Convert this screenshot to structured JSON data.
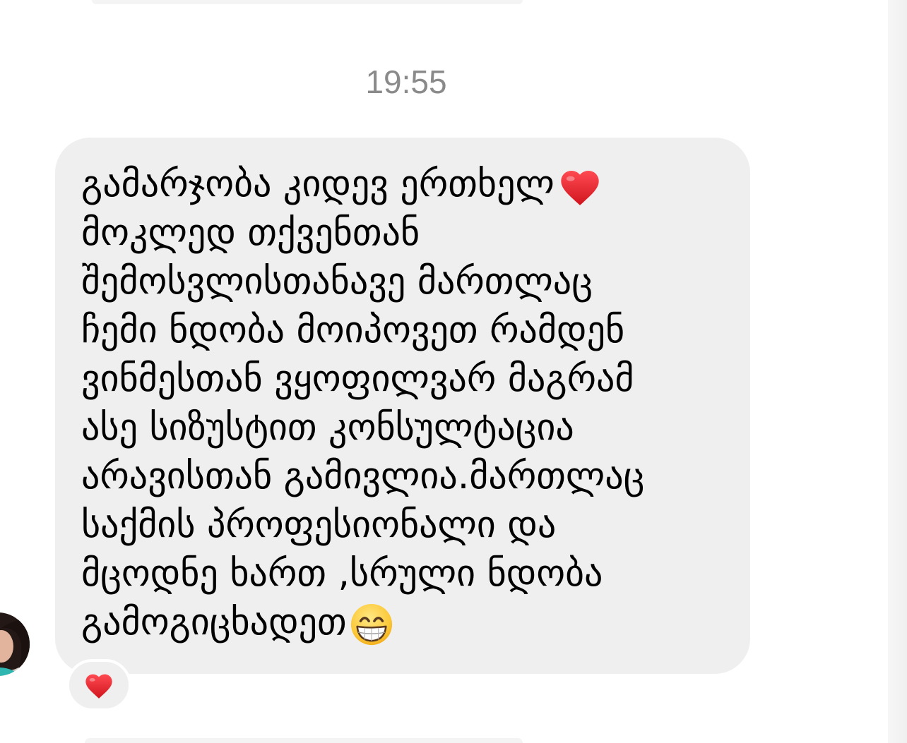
{
  "conversation": {
    "timestamp": "19:55",
    "message": {
      "lines": [
        "გამარჯობა კიდევ ერთხელ",
        "მოკლედ თქვენთან",
        "შემოსვლისთანავე მართლაც",
        "ჩემი ნდობა მოიპოვეთ რამდენ",
        "ვინმესთან ვყოფილვარ მაგრამ",
        "ასე სიზუსტით კონსულტაცია",
        "არავისთან გამივლია.მართლაც",
        "საქმის პროფესიონალი და",
        "მცოდნე ხართ ,სრული ნდობა",
        "გამოგიცხადეთ"
      ],
      "inline_emoji_icons": [
        "red-heart-emoji",
        "grinning-face-emoji"
      ]
    },
    "reaction": {
      "icon": "red-heart-emoji"
    },
    "sender": {
      "avatar_icon": "avatar-photo"
    }
  },
  "colors": {
    "bubble_background": "#efefef",
    "message_text": "#000000",
    "timestamp_text": "#8a8a8a",
    "heart_red": "#e2202b",
    "page_background": "#ffffff"
  }
}
